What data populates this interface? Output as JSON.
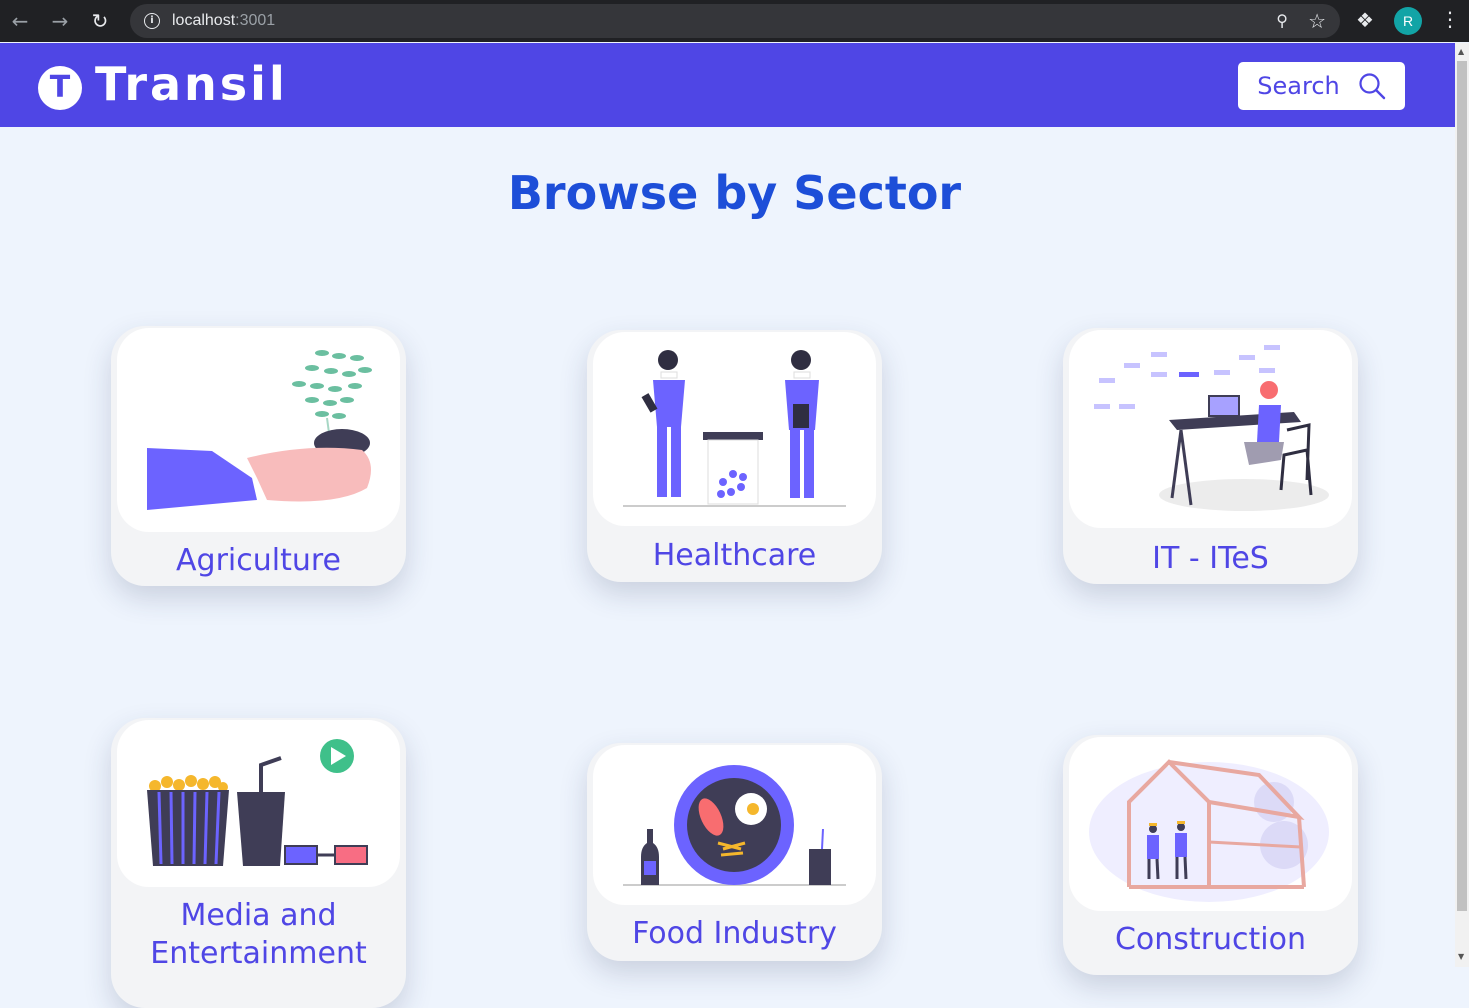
{
  "browser": {
    "url_host": "localhost",
    "url_port": ":3001",
    "profile_initial": "R"
  },
  "header": {
    "logo_letter": "T",
    "brand": "Transil",
    "search_label": "Search"
  },
  "page": {
    "title": "Browse by Sector"
  },
  "sectors": [
    {
      "label": "Agriculture"
    },
    {
      "label": "Healthcare"
    },
    {
      "label": "IT - ITeS"
    },
    {
      "label": "Media and Entertainment"
    },
    {
      "label": "Food Industry"
    },
    {
      "label": "Construction"
    }
  ],
  "colors": {
    "primary": "#4f46e5",
    "title": "#1d4ed8",
    "background": "#eef4fd"
  }
}
